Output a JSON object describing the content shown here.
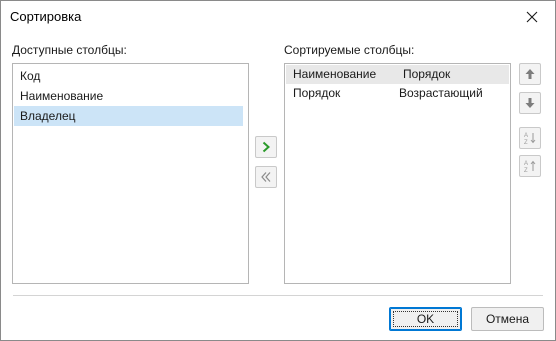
{
  "window": {
    "title": "Сортировка"
  },
  "available": {
    "label": "Доступные столбцы:",
    "items": [
      {
        "label": "Код",
        "selected": false
      },
      {
        "label": "Наименование",
        "selected": false
      },
      {
        "label": "Владелец",
        "selected": true
      }
    ]
  },
  "sorted": {
    "label": "Сортируемые столбцы:",
    "columns": [
      "Наименование",
      "Порядок"
    ],
    "rows": [
      {
        "column": "Порядок",
        "order": "Возрастающий"
      }
    ]
  },
  "icons": {
    "move_right": "chevron-right-icon",
    "move_left": "double-chevron-left-icon",
    "move_up": "arrow-up-icon",
    "move_down": "arrow-down-icon",
    "sort_asc": "sort-ascending-icon",
    "sort_desc": "sort-descending-icon",
    "close": "close-icon"
  },
  "colors": {
    "selection": "#cce4f7",
    "accent": "#0078d4",
    "move_arrow": "#2a9a2a"
  },
  "buttons": {
    "ok": "OK",
    "cancel": "Отмена"
  }
}
